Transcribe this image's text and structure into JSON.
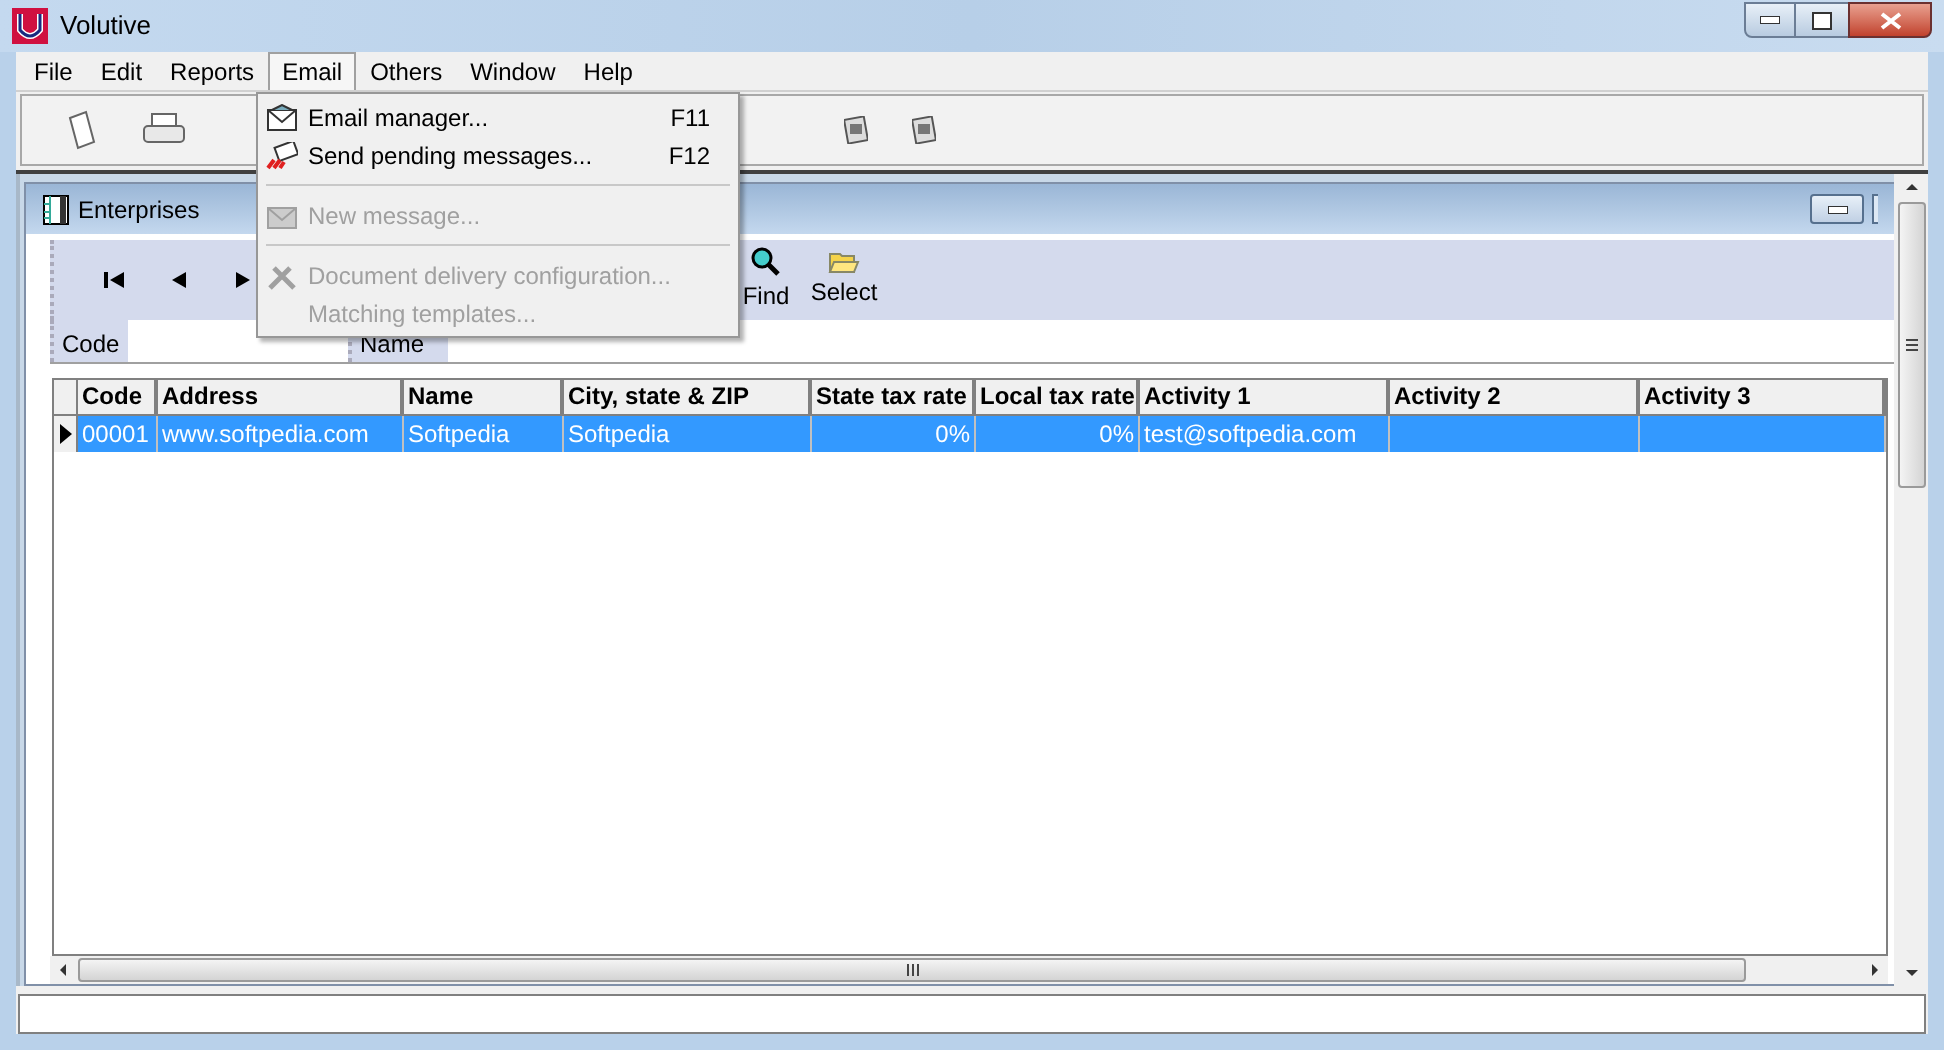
{
  "window": {
    "title": "Volutive"
  },
  "menu": [
    {
      "label": "File",
      "selected": false
    },
    {
      "label": "Edit",
      "selected": false
    },
    {
      "label": "Reports",
      "selected": false
    },
    {
      "label": "Email",
      "selected": true
    },
    {
      "label": "Others",
      "selected": false
    },
    {
      "label": "Window",
      "selected": false
    },
    {
      "label": "Help",
      "selected": false
    }
  ],
  "dropdown": [
    {
      "kind": "item",
      "label": "Email manager...",
      "shortcut": "F11",
      "disabled": false
    },
    {
      "kind": "item",
      "label": "Send pending messages...",
      "shortcut": "F12",
      "disabled": false
    },
    {
      "kind": "separator"
    },
    {
      "kind": "item",
      "label": "New message...",
      "disabled": true
    },
    {
      "kind": "separator"
    },
    {
      "kind": "item",
      "label": "Document delivery configuration...",
      "disabled": true
    },
    {
      "kind": "item",
      "label": "Matching templates...",
      "disabled": true
    }
  ],
  "child_window": {
    "title": "Enterprises",
    "toolbar": [
      {
        "kind": "first"
      },
      {
        "kind": "prev"
      },
      {
        "kind": "next"
      },
      {
        "kind": "find",
        "label": "Find"
      },
      {
        "kind": "select",
        "label": "Select"
      }
    ],
    "fields": [
      {
        "label": "Code"
      },
      {
        "label": "Name"
      }
    ],
    "table": {
      "columns": [
        "Code",
        "Address",
        "Name",
        "City, state & ZIP",
        "State tax rate",
        "Local tax rate",
        "Activity 1",
        "Activity 2",
        "Activity 3"
      ],
      "rows": [
        {
          "selected": true,
          "cells": [
            "00001",
            "www.softpedia.com",
            "Softpedia",
            "Softpedia",
            "0%",
            "0%",
            "test@softpedia.com",
            "",
            ""
          ]
        }
      ]
    }
  }
}
